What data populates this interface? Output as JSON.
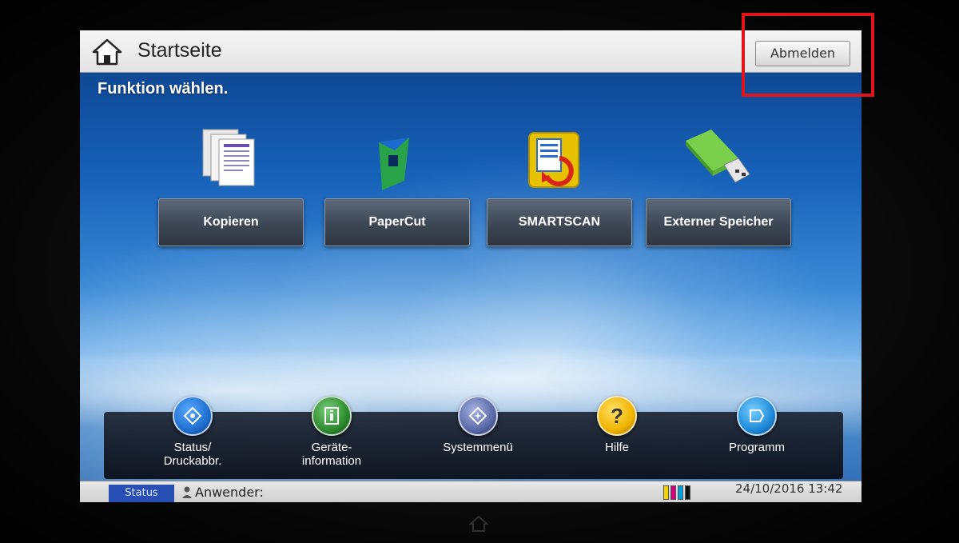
{
  "titlebar": {
    "title": "Startseite",
    "logout_label": "Abmelden",
    "home_icon": "home-icon"
  },
  "main": {
    "prompt": "Funktion wählen.",
    "functions": [
      {
        "label": "Kopieren",
        "icon": "copy-documents-icon"
      },
      {
        "label": "PaperCut",
        "icon": "papercut-logo-icon"
      },
      {
        "label": "SMARTSCAN",
        "icon": "smartscan-icon"
      },
      {
        "label": "Externer Speicher",
        "icon": "usb-drive-icon"
      }
    ]
  },
  "dock": {
    "items": [
      {
        "label": "Status/\nDruckabbr.",
        "icon": "eye-icon",
        "color": "#1e6fd0"
      },
      {
        "label": "Geräte-\ninformation",
        "icon": "device-info-icon",
        "color": "#2e8a2e"
      },
      {
        "label": "Systemmenü",
        "icon": "system-menu-icon",
        "color": "#5a6aa8"
      },
      {
        "label": "Hilfe",
        "icon": "help-icon",
        "color": "#f0b400"
      },
      {
        "label": "Programm",
        "icon": "program-icon",
        "color": "#1e8ad8"
      }
    ]
  },
  "statusbar": {
    "status_tab": "Status",
    "user_label": "Anwender:",
    "datetime": "24/10/2016 13:42",
    "toner_colors": [
      "#f2d200",
      "#d0007a",
      "#00a0e0",
      "#111111"
    ]
  },
  "colors": {
    "highlight": "#e0141a",
    "screen_bg": "#0e4fa0"
  }
}
